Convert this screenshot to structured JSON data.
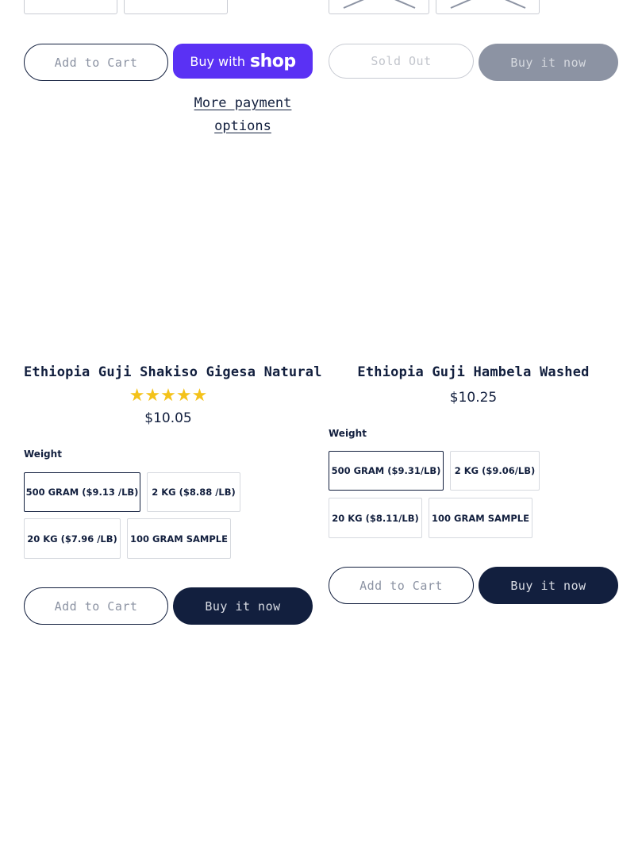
{
  "top_row": {
    "left": {
      "add_to_cart": "Add to Cart",
      "buy_with": "Buy with",
      "shop_brand": "shop",
      "more_payment": "More payment options"
    },
    "right": {
      "sold_out": "Sold Out",
      "buy_now": "Buy it now"
    }
  },
  "products": [
    {
      "title": "Ethiopia Guji Shakiso Gigesa Natural",
      "rating_stars": 5,
      "stars": "★★★★★",
      "price": "$10.05",
      "weight_label": "Weight",
      "variants": [
        "500 GRAM ($9.13 /LB)",
        "2 KG ($8.88 /LB)",
        "20 KG ($7.96 /LB)",
        "100 GRAM SAMPLE"
      ],
      "selected_variant": "500 GRAM ($9.13 /LB)",
      "add_to_cart": "Add to Cart",
      "buy_now": "Buy it now"
    },
    {
      "title": "Ethiopia Guji Hambela Washed",
      "price": "$10.25",
      "weight_label": "Weight",
      "variants": [
        "500 GRAM ($9.31/LB)",
        "2 KG ($9.06/LB)",
        "20 KG ($8.11/LB)",
        "100 GRAM SAMPLE"
      ],
      "selected_variant": "500 GRAM ($9.31/LB)",
      "add_to_cart": "Add to Cart",
      "buy_now": "Buy it now"
    }
  ],
  "colors": {
    "navy": "#121f3e",
    "shop_purple": "#5a31f4",
    "star_yellow": "#f4c21a",
    "disabled_gray": "#8c93a3"
  }
}
